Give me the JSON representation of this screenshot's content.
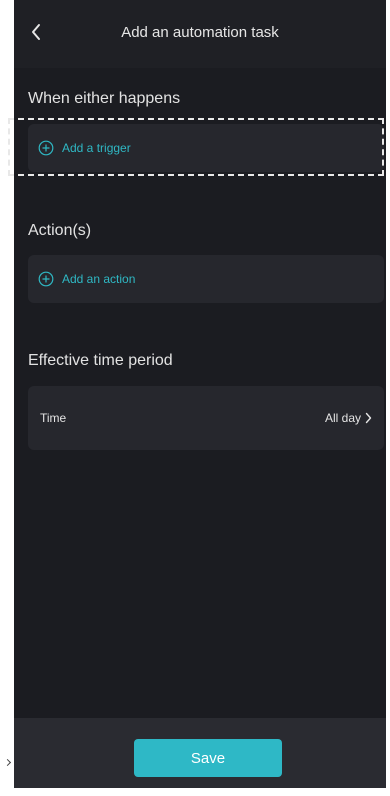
{
  "header": {
    "title": "Add an automation task",
    "back_icon": "chevron-left-icon"
  },
  "trigger_section": {
    "title": "When either happens",
    "add_label": "Add a trigger",
    "icon": "plus-circle-icon"
  },
  "action_section": {
    "title": "Action(s)",
    "add_label": "Add an action",
    "icon": "plus-circle-icon"
  },
  "time_section": {
    "title": "Effective time period",
    "row_label": "Time",
    "row_value": "All day",
    "chevron_icon": "chevron-right-icon"
  },
  "footer": {
    "save_label": "Save"
  },
  "colors": {
    "accent": "#2eb8c6",
    "background": "#1b1c21",
    "card": "#26272d",
    "text": "#e4e4e4"
  }
}
